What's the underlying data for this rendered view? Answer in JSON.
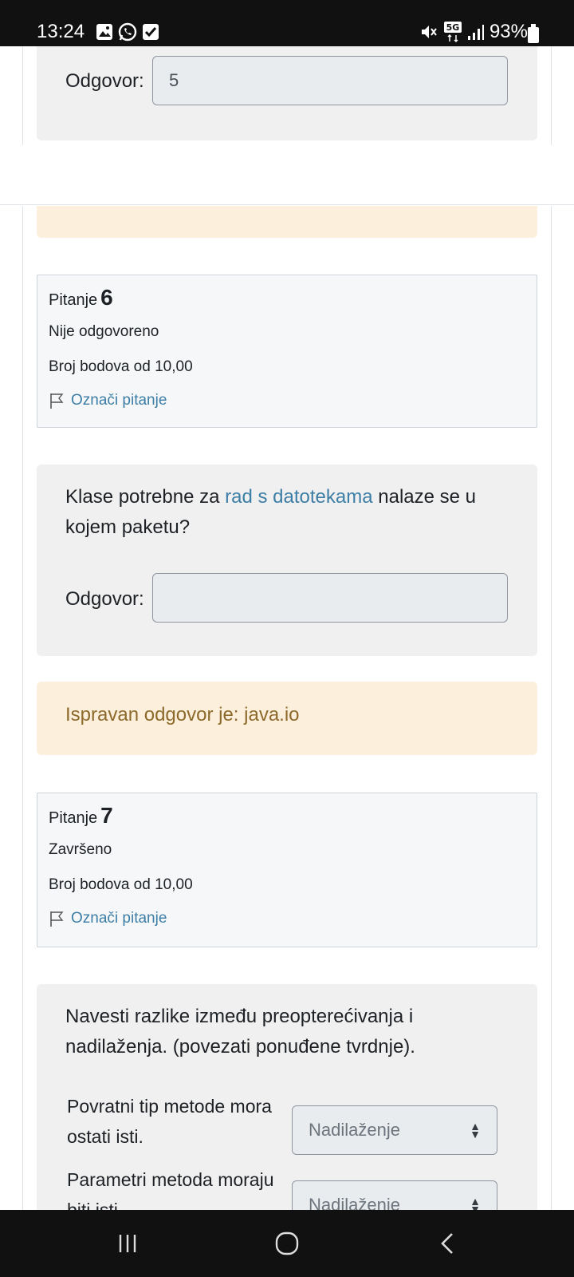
{
  "status_bar": {
    "time": "13:24",
    "battery": "93%",
    "network": "5G",
    "icons_left": [
      "image-icon",
      "whatsapp-icon",
      "checkbox-icon"
    ],
    "icons_right": [
      "mute-icon",
      "5g-icon",
      "signal-icon",
      "battery-icon"
    ]
  },
  "prev_question": {
    "answer_label": "Odgovor:",
    "answer_value": "5"
  },
  "question6": {
    "label": "Pitanje",
    "number": "6",
    "state": "Nije odgovoreno",
    "grade": "Broj bodova od 10,00",
    "flag": "Označi pitanje",
    "text_before": "Klase potrebne za",
    "text_link": "rad s datotekama",
    "text_after": "nalaze se u kojem paketu?",
    "answer_label": "Odgovor:",
    "answer_value": "",
    "feedback": "Ispravan odgovor je: java.io"
  },
  "question7": {
    "label": "Pitanje",
    "number": "7",
    "state": "Završeno",
    "grade": "Broj bodova od 10,00",
    "flag": "Označi pitanje",
    "text": "Navesti razlike između preopterećivanja i nadilaženja. (povezati ponuđene tvrdnje).",
    "rows": [
      {
        "statement": "Povratni tip metode mora ostati isti.",
        "selected": "Nadilaženje"
      },
      {
        "statement": "Parametri metoda moraju biti isti.",
        "selected": "Nadilaženje"
      }
    ]
  },
  "colors": {
    "link": "#3d7ea6",
    "feedback_bg": "#fcefdc",
    "feedback_text": "#8d6a2b",
    "question_bg": "#f0f0f0",
    "info_bg": "#f6f7f9"
  }
}
